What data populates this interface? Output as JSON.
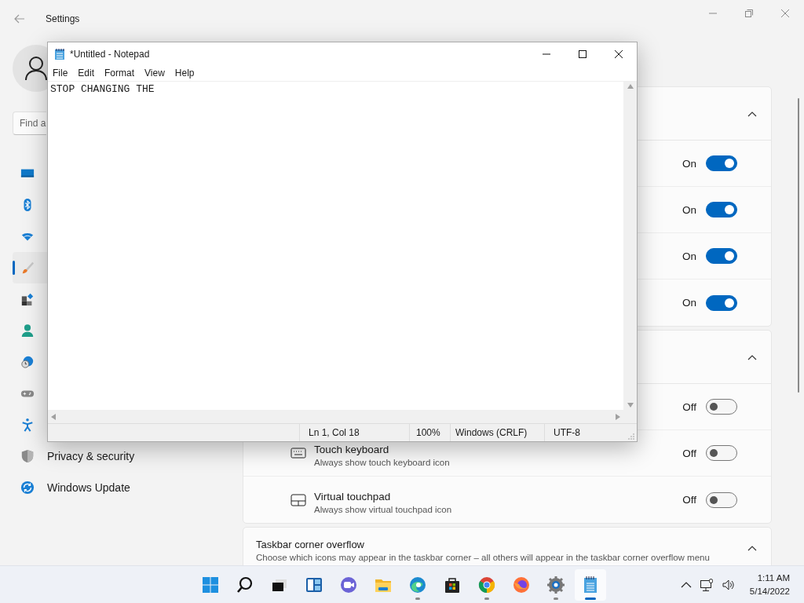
{
  "settings": {
    "title": "Settings",
    "search": {
      "placeholder": "Find a"
    },
    "nav": [
      {
        "selected": false
      },
      {
        "selected": false
      },
      {
        "selected": false
      },
      {
        "selected": true
      },
      {
        "selected": false
      },
      {
        "selected": false
      },
      {
        "selected": false
      },
      {
        "selected": false
      },
      {
        "selected": false
      },
      {
        "label": "Privacy & security",
        "selected": false
      },
      {
        "label": "Windows Update",
        "selected": false
      }
    ],
    "groups": [
      {
        "expanded": true,
        "rows": [
          {
            "state": "On",
            "on": true
          },
          {
            "state": "On",
            "on": true
          },
          {
            "state": "On",
            "on": true
          },
          {
            "state": "On",
            "on": true
          }
        ]
      },
      {
        "expanded": true,
        "rows": [
          {
            "state": "Off",
            "on": false
          },
          {
            "label": "Touch keyboard",
            "description": "Always show touch keyboard icon",
            "state": "Off",
            "on": false
          },
          {
            "label": "Virtual touchpad",
            "description": "Always show virtual touchpad icon",
            "state": "Off",
            "on": false
          }
        ]
      },
      {
        "title": "Taskbar corner overflow",
        "description": "Choose which icons may appear in the taskbar corner – all others will appear in the taskbar corner overflow menu",
        "expanded": true
      }
    ]
  },
  "notepad": {
    "title": "*Untitled - Notepad",
    "menu": [
      "File",
      "Edit",
      "Format",
      "View",
      "Help"
    ],
    "text": "STOP CHANGING THE",
    "status": [
      "Ln 1, Col 18",
      "100%",
      "Windows (CRLF)",
      "UTF-8"
    ]
  },
  "taskbar": {
    "apps": [
      {
        "running": false,
        "selected": false
      },
      {
        "running": false,
        "selected": false
      },
      {
        "running": false,
        "selected": false
      },
      {
        "running": false,
        "selected": false
      },
      {
        "running": false,
        "selected": false
      },
      {
        "running": false,
        "selected": false
      },
      {
        "running": true,
        "selected": false
      },
      {
        "running": false,
        "selected": false
      },
      {
        "running": true,
        "selected": false
      },
      {
        "running": false,
        "selected": false
      },
      {
        "running": true,
        "selected": false
      },
      {
        "running": true,
        "selected": true
      }
    ],
    "time": "1:11 AM",
    "date": "5/14/2022"
  }
}
